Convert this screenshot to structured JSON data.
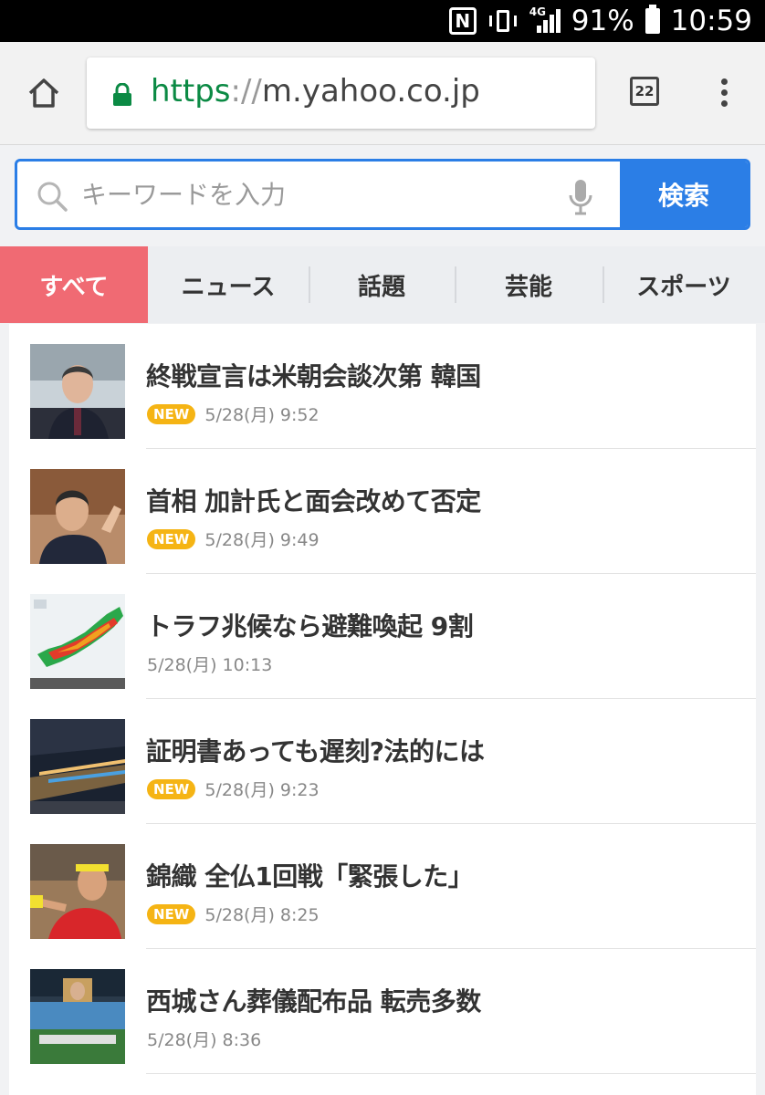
{
  "status_bar": {
    "nfc_label": "N",
    "network": "4G",
    "battery": "91%",
    "time": "10:59"
  },
  "browser": {
    "url_scheme": "https",
    "url_sep": "://",
    "url_host": "m.yahoo.co.jp",
    "tab_count": "22"
  },
  "search": {
    "placeholder": "キーワードを入力",
    "button_label": "検索"
  },
  "tabs": [
    {
      "label": "すべて",
      "active": true
    },
    {
      "label": "ニュース",
      "active": false
    },
    {
      "label": "話題",
      "active": false
    },
    {
      "label": "芸能",
      "active": false
    },
    {
      "label": "スポーツ",
      "active": false
    }
  ],
  "news": [
    {
      "title": "終戦宣言は米朝会談次第 韓国",
      "badge": "NEW",
      "time": "5/28(月) 9:52"
    },
    {
      "title": "首相 加計氏と面会改めて否定",
      "badge": "NEW",
      "time": "5/28(月) 9:49"
    },
    {
      "title": "トラフ兆候なら避難喚起 9割",
      "badge": "",
      "time": "5/28(月) 10:13"
    },
    {
      "title": "証明書あっても遅刻?法的には",
      "badge": "NEW",
      "time": "5/28(月) 9:23"
    },
    {
      "title": "錦織 全仏1回戦「緊張した」",
      "badge": "NEW",
      "time": "5/28(月) 8:25"
    },
    {
      "title": "西城さん葬儀配布品 転売多数",
      "badge": "",
      "time": "5/28(月) 8:36"
    }
  ],
  "colors": {
    "accent_blue": "#2b7ee6",
    "active_tab": "#f06a73",
    "new_badge": "#f5b414",
    "https_green": "#0b8a44"
  }
}
